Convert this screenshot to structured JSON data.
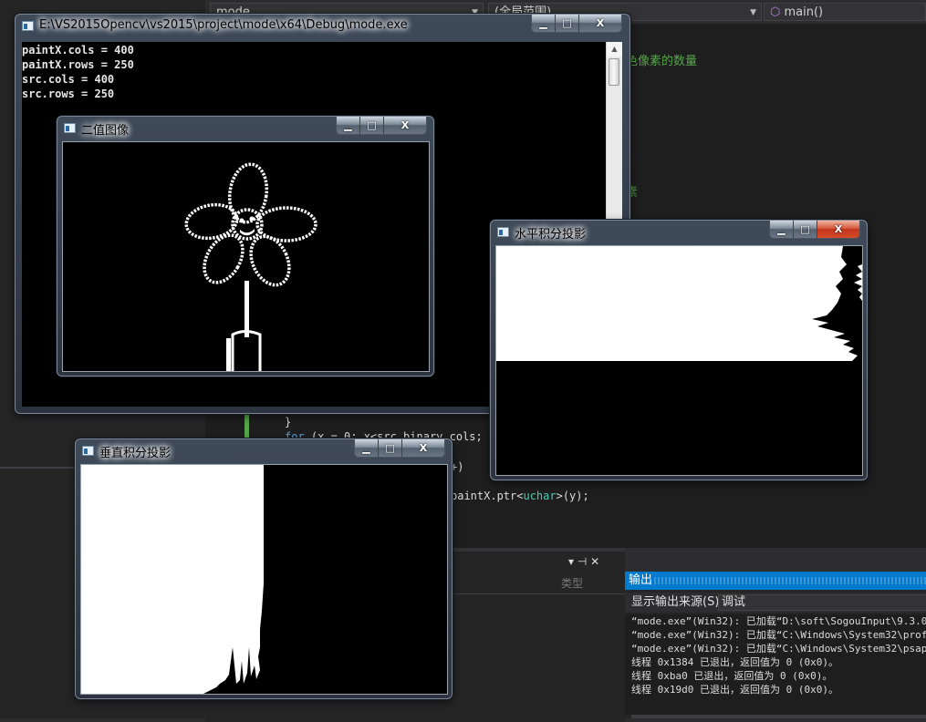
{
  "ide": {
    "dropdown_left": "mode",
    "dropdown_mid": "(全局范围)",
    "dropdown_right": "main()",
    "comment_fragment": "色像素的数量",
    "comment_fragment2": "素",
    "code_lines": {
      "brace": "}",
      "for_kw": "for",
      "for_rest": " (x = 0; x<src_binary.cols; x",
      "incr": "+)",
      "ptr_pre": "paintX.ptr<",
      "ptr_type": "uchar",
      "ptr_post": ">(y);"
    },
    "lower_pane": {
      "col_header": "类型",
      "pin_icons": "▾ ⊣ ✕"
    },
    "output": {
      "title": "输出",
      "source_label": "显示输出来源(S):",
      "source_value": "调试",
      "lines": [
        "“mode.exe”(Win32): 已加载“D:\\soft\\SogouInput\\9.3.0",
        "“mode.exe”(Win32): 已加载“C:\\Windows\\System32\\prof",
        "“mode.exe”(Win32): 已加载“C:\\Windows\\System32\\psap",
        "线程 0x1384 已退出，返回值为 0 (0x0)。",
        "线程 0xba0 已退出，返回值为 0 (0x0)。",
        "线程 0x19d0 已退出，返回值为 0 (0x0)。"
      ]
    }
  },
  "console": {
    "title": "E:\\VS2015Opencv\\vs2015\\project\\mode\\x64\\Debug\\mode.exe",
    "lines": [
      "paintX.cols = 400",
      "paintX.rows = 250",
      "src.cols = 400",
      "src.rows = 250"
    ]
  },
  "binary_window": {
    "title": "二值图像"
  },
  "horizontal_window": {
    "title": "水平积分投影"
  },
  "vertical_window": {
    "title": "垂直积分投影"
  },
  "captions": {
    "min": "▁",
    "max": "□",
    "close": "X"
  },
  "colors": {
    "ide_bg": "#1e1e1e",
    "accent": "#007acc",
    "close_red": "#c2361b"
  }
}
